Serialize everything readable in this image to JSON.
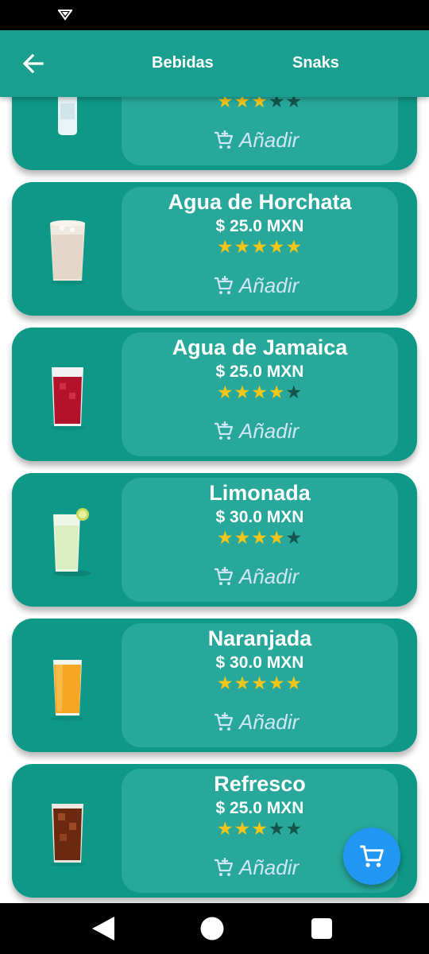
{
  "header": {
    "tabs": [
      {
        "label": "Bebidas"
      },
      {
        "label": "Snaks"
      }
    ]
  },
  "colors": {
    "app_bar": "#1a9e8f",
    "card_bg": "#0e9888",
    "card_inner": "#27a89a",
    "star_on": "#f5c518",
    "star_off": "#14544c",
    "fab": "#2196f3"
  },
  "products": [
    {
      "name": "",
      "price": "",
      "rating": 3,
      "add_label": "Añadir",
      "image": "water-bottle"
    },
    {
      "name": "Agua de Horchata",
      "price": "$ 25.0 MXN",
      "rating": 5,
      "add_label": "Añadir",
      "image": "horchata-glass"
    },
    {
      "name": "Agua de Jamaica",
      "price": "$ 25.0 MXN",
      "rating": 4,
      "add_label": "Añadir",
      "image": "jamaica-glass"
    },
    {
      "name": "Limonada",
      "price": "$ 30.0 MXN",
      "rating": 4,
      "add_label": "Añadir",
      "image": "lemonade-glass"
    },
    {
      "name": "Naranjada",
      "price": "$ 30.0 MXN",
      "rating": 5,
      "add_label": "Añadir",
      "image": "orange-juice-glass"
    },
    {
      "name": "Refresco",
      "price": "$ 25.0 MXN",
      "rating": 3,
      "add_label": "Añadir",
      "image": "soda-glass"
    }
  ],
  "fab": {
    "icon": "shopping-cart-icon"
  }
}
